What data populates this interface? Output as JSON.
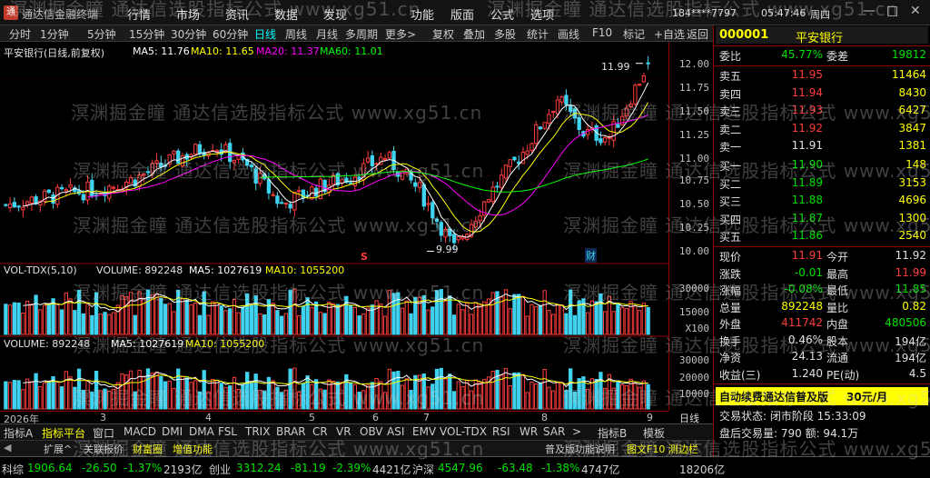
{
  "app": {
    "title": "通达信金融终端",
    "user": "184****7797",
    "clock": "05:47:46",
    "weekday": "周四",
    "menus": [
      "行情",
      "市场",
      "资讯",
      "数据",
      "发现",
      "功能",
      "版面",
      "公式",
      "选项"
    ]
  },
  "toolbar": {
    "periods": [
      "分时",
      "1分钟",
      "5分钟",
      "15分钟",
      "30分钟",
      "60分钟",
      "日线",
      "周线",
      "月线",
      "多周期",
      "更多>"
    ],
    "active_period": "日线",
    "tools": [
      "复权",
      "叠加",
      "多股",
      "统计",
      "画线",
      "F10",
      "标记",
      "+自选",
      "返回"
    ]
  },
  "chart": {
    "header": {
      "name": "平安银行(日线,前复权)",
      "ma5": "MA5: 11.76",
      "ma10": "MA10: 11.65",
      "ma20": "MA20: 11.37",
      "ma60": "MA60: 11.01"
    },
    "high_mark": "11.99",
    "low_mark": "9.99",
    "marker_s": "S",
    "marker_cai": "财",
    "vol_tdx": {
      "title": "VOL-TDX(5,10)",
      "volume": "VOLUME: 892248",
      "ma5": "MA5: 1027619",
      "ma10": "MA10: 1055200"
    },
    "volume": {
      "title": "VOLUME: 892248",
      "ma5": "MA5: 1027619",
      "ma10": "MA10: 1055200"
    },
    "price_ticks": [
      "12.00",
      "11.75",
      "11.50",
      "11.25",
      "11.00",
      "10.75",
      "10.50",
      "10.25",
      "10.00"
    ],
    "vol1_ticks": [
      "30000",
      "15000",
      "X100"
    ],
    "vol2_ticks": [
      "30000",
      "20000",
      "10000"
    ],
    "dates": [
      "2026年",
      "3",
      "4",
      "5",
      "6",
      "7",
      "8",
      "9"
    ],
    "right_label": "日线",
    "colors": {
      "up": "#ff3c3c",
      "down": "#3fd3f0",
      "ma5": "#ffffff",
      "ma10": "#ffff00",
      "ma20": "#ff00ff",
      "ma60": "#00ff00",
      "grid": "#8b0000"
    }
  },
  "chart_data": {
    "type": "candlestick",
    "title": "平安银行(日线,前复权)",
    "ylim": [
      9.9,
      12.1
    ],
    "high": 11.99,
    "low": 9.99,
    "ma_latest": {
      "MA5": 11.76,
      "MA10": 11.65,
      "MA20": 11.37,
      "MA60": 11.01
    },
    "y_ticks": [
      10.0,
      10.25,
      10.5,
      10.75,
      11.0,
      11.25,
      11.5,
      11.75,
      12.0
    ],
    "x_ticks": [
      "2026年",
      "3",
      "4",
      "5",
      "6",
      "7",
      "8",
      "9"
    ],
    "last_volume": 892248,
    "vol_ma5": 1027619,
    "vol_ma10": 1055200
  },
  "tabs": {
    "items": [
      "指标A",
      "指标平台",
      "窗口",
      "MACD",
      "DMI",
      "DMA",
      "FSL",
      "TRIX",
      "BRAR",
      "CR",
      "VR",
      "OBV",
      "ASI",
      "EMV",
      "VOL-TDX",
      "RSI",
      "WR",
      "SAR",
      ">",
      "指标B",
      "模板"
    ],
    "active": "指标平台"
  },
  "tabs2": {
    "items": [
      "扩展^",
      "关联报价",
      "财富圈",
      "增值功能"
    ],
    "right": [
      "普及版功能说明",
      "图文F10 测边栏"
    ]
  },
  "quote": {
    "code": "000001",
    "name": "平安银行",
    "weibi_label": "委比",
    "weibi": "45.77%",
    "weicha_label": "委差",
    "weicha": "19812",
    "asks": [
      {
        "label": "卖五",
        "price": "11.95",
        "vol": "11464"
      },
      {
        "label": "卖四",
        "price": "11.94",
        "vol": "8430"
      },
      {
        "label": "卖三",
        "price": "11.93",
        "vol": "6427"
      },
      {
        "label": "卖二",
        "price": "11.92",
        "vol": "3847"
      },
      {
        "label": "卖一",
        "price": "11.91",
        "vol": "1381"
      }
    ],
    "bids": [
      {
        "label": "买一",
        "price": "11.90",
        "vol": "148"
      },
      {
        "label": "买二",
        "price": "11.89",
        "vol": "3153"
      },
      {
        "label": "买三",
        "price": "11.88",
        "vol": "4696"
      },
      {
        "label": "买四",
        "price": "11.87",
        "vol": "1300"
      },
      {
        "label": "买五",
        "price": "11.86",
        "vol": "2540"
      }
    ],
    "stats": [
      {
        "l1": "现价",
        "v1": "11.91",
        "l2": "今开",
        "v2": "11.92",
        "c1": "#ff3c3c",
        "c2": "#e0e0e0"
      },
      {
        "l1": "涨跌",
        "v1": "-0.01",
        "l2": "最高",
        "v2": "11.99",
        "c1": "#00e000",
        "c2": "#ff3c3c"
      },
      {
        "l1": "涨幅",
        "v1": "-0.08%",
        "l2": "最低",
        "v2": "11.85",
        "c1": "#00e000",
        "c2": "#00e000"
      },
      {
        "l1": "总量",
        "v1": "892248",
        "l2": "量比",
        "v2": "0.82",
        "c1": "#ffff00",
        "c2": "#ffff00"
      },
      {
        "l1": "外盘",
        "v1": "411742",
        "l2": "内盘",
        "v2": "480506",
        "c1": "#ff3c3c",
        "c2": "#00e000"
      },
      {
        "l1": "换手",
        "v1": "0.46%",
        "l2": "股本",
        "v2": "194亿",
        "c1": "#e0e0e0",
        "c2": "#e0e0e0"
      },
      {
        "l1": "净资",
        "v1": "24.13",
        "l2": "流通",
        "v2": "194亿",
        "c1": "#e0e0e0",
        "c2": "#e0e0e0"
      },
      {
        "l1": "收益(三)",
        "v1": "1.240",
        "l2": "PE(动)",
        "v2": "4.5",
        "c1": "#e0e0e0",
        "c2": "#e0e0e0"
      }
    ],
    "promo": "自动续费通达信普及版",
    "promo_price": "30元/月",
    "trade_state": "交易状态: 闭市阶段 15:33:09",
    "after_hours": "盘后交易量: 790  额: 94.1万"
  },
  "status": {
    "items": [
      {
        "text": "科综",
        "c": "#d0d0d0"
      },
      {
        "text": "1906.64",
        "c": "#00e000"
      },
      {
        "text": "-26.50",
        "c": "#00e000"
      },
      {
        "text": "-1.37%",
        "c": "#00e000"
      },
      {
        "text": "2193亿",
        "c": "#d0d0d0"
      },
      {
        "text": "创业",
        "c": "#d0d0d0"
      },
      {
        "text": "3312.24",
        "c": "#00e000"
      },
      {
        "text": "-81.19",
        "c": "#00e000"
      },
      {
        "text": "-2.39%",
        "c": "#00e000"
      },
      {
        "text": "4421亿",
        "c": "#d0d0d0"
      },
      {
        "text": "沪深",
        "c": "#d0d0d0"
      },
      {
        "text": "4547.96",
        "c": "#00e000"
      },
      {
        "text": "-63.48",
        "c": "#00e000"
      },
      {
        "text": "-1.38%",
        "c": "#00e000"
      },
      {
        "text": "4747亿",
        "c": "#d0d0d0"
      },
      {
        "text": "18206亿",
        "c": "#d0d0d0"
      }
    ]
  },
  "watermark": "溟渊掘金瞳 通达信选股指标公式 www.xg51.cn"
}
